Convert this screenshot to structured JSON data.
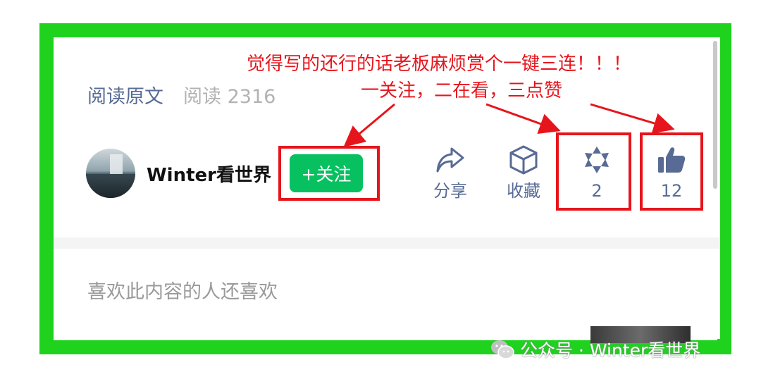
{
  "article_footer": {
    "read_original": "阅读原文",
    "read_count": "阅读 2316"
  },
  "author": {
    "name": "Winter看世界",
    "follow_label": "+关注"
  },
  "actions": {
    "share": {
      "icon": "share-arrow-icon",
      "label": "分享"
    },
    "favorite": {
      "icon": "cube-icon",
      "label": "收藏"
    },
    "watch": {
      "icon": "flower-watch-icon",
      "count": "2"
    },
    "like": {
      "icon": "thumbs-up-icon",
      "count": "12"
    }
  },
  "recommend_section": {
    "title": "喜欢此内容的人还喜欢"
  },
  "annotation": {
    "line1": "觉得写的还行的话老板麻烦赏个一键三连！！！",
    "line2": "一关注，二在看，三点赞"
  },
  "watermark": {
    "text": "公众号 · Winter看世界",
    "icon": "wechat-icon"
  },
  "colors": {
    "frame_green": "#1ED21E",
    "annotation_red": "#E6151C",
    "follow_green": "#07C160",
    "link_blue": "#576B95",
    "icon_blue": "#576B95"
  }
}
